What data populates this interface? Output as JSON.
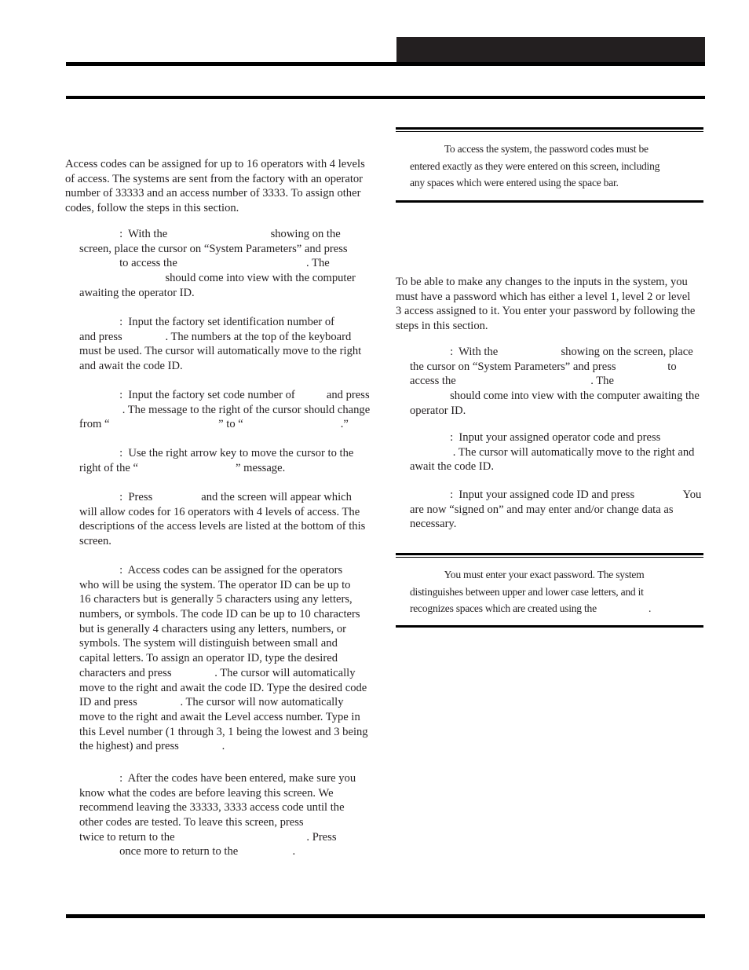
{
  "header": {
    "title_block_text": ""
  },
  "left_column": {
    "intro": [
      "Access codes can be assigned for up to 16 operators with 4 levels",
      "of access. The systems are sent from the factory with an operator",
      "number of 33333 and an access number of 3333. To assign other",
      "codes, follow the steps in this section."
    ],
    "steps": [
      {
        "lines": [
          "              :  With the                                    showing on the",
          "screen, place the cursor on “System Parameters” and press",
          "              to access the                                             . The",
          "                              should come into view with the computer",
          "awaiting the operator ID."
        ]
      },
      {
        "lines": [
          "              :  Input the factory set identification number of",
          "and press               . The numbers at the top of the keyboard",
          "must be used. The cursor will automatically move to the right",
          "and await the code ID."
        ]
      },
      {
        "lines": [
          "              :  Input the factory set code number of           and press",
          "               . The message to the right of the cursor should change",
          "from “                                      ” to “                                  .”"
        ]
      },
      {
        "lines": [
          "              :  Use the right arrow key to move the cursor to the",
          "right of the “                                  ” message."
        ]
      },
      {
        "lines": [
          "              :  Press                 and the screen will appear which",
          "will allow codes for 16 operators with 4 levels of access. The",
          "descriptions of the access levels are listed at the bottom of this",
          "screen."
        ]
      },
      {
        "lines": [
          "              :  Access codes can be assigned for the operators",
          "who will be using the system. The operator ID can be up to",
          "16 characters but is generally 5 characters using any letters,",
          "numbers, or symbols. The code ID can be up to 10 characters",
          "but is generally 4 characters using any letters, numbers, or",
          "symbols. The system will distinguish between small and",
          "capital letters. To assign an operator ID, type the desired",
          "characters and press               . The cursor will automatically",
          "move to the right and await the code ID. Type the desired code",
          "ID and press               . The cursor will now automatically",
          "move to the right and await the Level access number. Type in",
          "this Level number (1 through 3, 1 being the lowest and 3 being",
          "the highest) and press               ."
        ]
      },
      {
        "lines": [
          "              :  After the codes have been entered, make sure you",
          "know what the codes are before leaving this screen. We",
          "recommend leaving the 33333, 3333 access code until the",
          "other codes are tested. To leave this screen, press",
          "twice to return to the                                              . Press",
          "              once more to return to the                   ."
        ]
      }
    ]
  },
  "right_column": {
    "note_1": [
      "              To access the system, the password codes must be",
      "entered exactly as they were entered on this screen, including",
      "any spaces which were entered using the space bar."
    ],
    "intro": [
      "To be able to make any changes to the inputs in the system, you",
      "must have a password which has either a level 1, level 2 or level",
      "3 access assigned to it. You enter your password by following the",
      "steps in this section."
    ],
    "steps": [
      {
        "lines": [
          "              :  With the                      showing on the screen, place",
          "the cursor on “System Parameters” and press                  to",
          "access the                                               . The",
          "              should come into view with the computer awaiting the",
          "operator ID."
        ]
      },
      {
        "lines": [
          "              :  Input your assigned operator code and press",
          "               . The cursor will automatically move to the right and",
          "await the code ID."
        ]
      },
      {
        "lines": [
          "              :  Input your assigned code ID and press                 You",
          "are now “signed on” and may enter and/or change data as",
          "necessary."
        ]
      }
    ],
    "note_2": [
      "              You must enter your exact password. The system",
      "distinguishes between upper and lower case letters, and it",
      "recognizes spaces which are created using the                     ."
    ]
  }
}
